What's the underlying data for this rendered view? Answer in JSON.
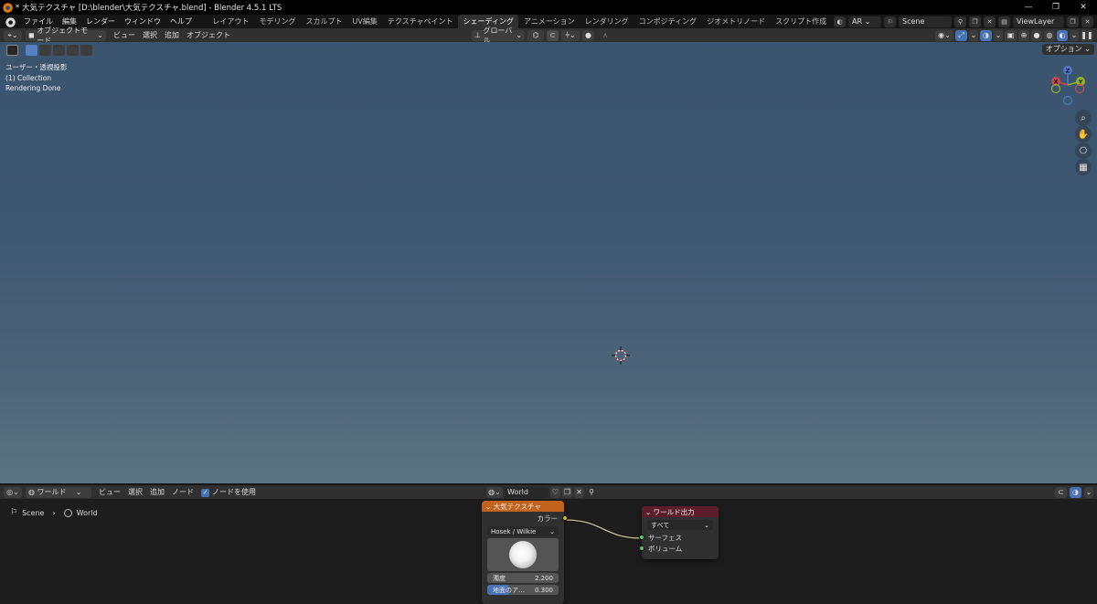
{
  "window": {
    "title": "* 大気テクスチャ [D:\\blender\\大気テクスチャ.blend] - Blender 4.5.1 LTS",
    "controls": [
      "—",
      "❐",
      "✕"
    ]
  },
  "menubar": {
    "items": [
      "ファイル",
      "編集",
      "レンダー",
      "ウィンドウ",
      "ヘルプ"
    ],
    "workspaces": [
      "レイアウト",
      "モデリング",
      "スカルプト",
      "UV編集",
      "テクスチャペイント",
      "シェーディング",
      "アニメーション",
      "レンダリング",
      "コンポジティング",
      "ジオメトリノード",
      "スクリプト作成"
    ],
    "active_workspace": "シェーディング",
    "add_tab": "+",
    "render_engine": "AR",
    "scene": "Scene",
    "view_layer": "ViewLayer"
  },
  "viewport_header": {
    "mode": "オブジェクトモード",
    "menus": [
      "ビュー",
      "選択",
      "追加",
      "オブジェクト"
    ],
    "transform_orientation": "グローバル",
    "options_label": "オプション"
  },
  "viewport": {
    "info_lines": [
      "ユーザー・透視投影",
      "(1) Collection",
      "Rendering Done"
    ],
    "gizmo_axes": {
      "x": "X",
      "y": "Y",
      "z": "Z"
    }
  },
  "node_editor_header": {
    "type": "ワールド",
    "menus": [
      "ビュー",
      "選択",
      "追加",
      "ノード"
    ],
    "use_nodes_label": "ノードを使用",
    "use_nodes": true,
    "world_name": "World"
  },
  "breadcrumb": {
    "scene": "Scene",
    "world": "World"
  },
  "nodes": {
    "sky": {
      "title": "大気テクスチャ",
      "output": "カラー",
      "sky_type": "Hosek / Wilkie",
      "turbidity_label": "濁度",
      "turbidity_value": "2.200",
      "albedo_label": "地面のア…",
      "albedo_value": "0.300",
      "header_color": "#c2631d"
    },
    "world_output": {
      "title": "ワールド出力",
      "target": "すべて",
      "surface": "サーフェス",
      "volume": "ボリューム",
      "header_color": "#5d1e2b"
    }
  }
}
